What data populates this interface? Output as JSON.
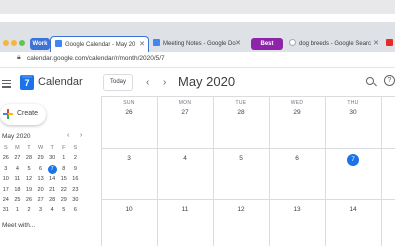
{
  "browser": {
    "tabs": [
      {
        "label": "Google Calendar - May 20",
        "active": true
      },
      {
        "label": "Meeting Notes - Google Do",
        "active": false
      },
      {
        "label": "dog breeds - Google Searc",
        "active": false
      }
    ],
    "groups": [
      {
        "label": "Work",
        "color": "#3b73d6"
      },
      {
        "label": "Best Friend",
        "color": "#8e24aa"
      }
    ],
    "url": "calendar.google.com/calendar/r/month/2020/5/7"
  },
  "calendar": {
    "app_title": "Calendar",
    "logo_day": "7",
    "today_label": "Today",
    "prev_icon": "‹",
    "next_icon": "›",
    "month_title": "May 2020",
    "create_label": "Create",
    "accent": "#1a73e8"
  },
  "mini": {
    "title": "May 2020",
    "prev": "‹",
    "next": "›",
    "weekday_labels": [
      "S",
      "M",
      "T",
      "W",
      "T",
      "F",
      "S"
    ],
    "weeks": [
      [
        "26",
        "27",
        "28",
        "29",
        "30",
        "1",
        "2"
      ],
      [
        "3",
        "4",
        "5",
        "6",
        "7",
        "8",
        "9"
      ],
      [
        "10",
        "11",
        "12",
        "13",
        "14",
        "15",
        "16"
      ],
      [
        "17",
        "18",
        "19",
        "20",
        "21",
        "22",
        "23"
      ],
      [
        "24",
        "25",
        "26",
        "27",
        "28",
        "29",
        "30"
      ],
      [
        "31",
        "1",
        "2",
        "3",
        "4",
        "5",
        "6"
      ]
    ],
    "today_week": 1,
    "today_col": 4,
    "meet_label": "Meet with..."
  },
  "month": {
    "weekdays": [
      "SUN",
      "MON",
      "TUE",
      "WED",
      "THU"
    ],
    "rows": [
      [
        "26",
        "27",
        "28",
        "29",
        "30"
      ],
      [
        "3",
        "4",
        "5",
        "6",
        "7"
      ],
      [
        "10",
        "11",
        "12",
        "13",
        "14"
      ]
    ],
    "today_row": 1,
    "today_col": 4
  }
}
